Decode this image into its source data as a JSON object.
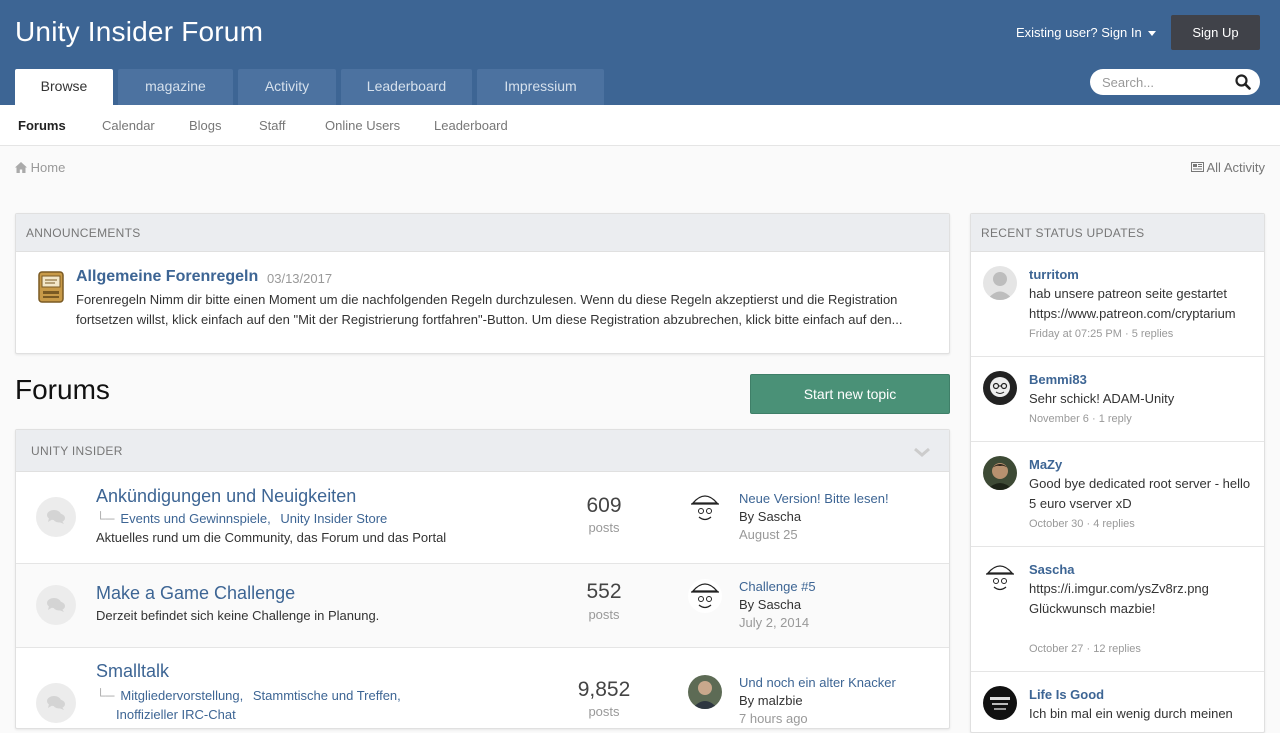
{
  "header": {
    "site_title": "Unity Insider Forum",
    "signin_label": "Existing user? Sign In",
    "signup_label": "Sign Up",
    "tabs": [
      {
        "label": "Browse"
      },
      {
        "label": "magazine"
      },
      {
        "label": "Activity"
      },
      {
        "label": "Leaderboard"
      },
      {
        "label": "Impressium"
      }
    ],
    "search_placeholder": "Search..."
  },
  "subnav": {
    "items": [
      {
        "label": "Forums"
      },
      {
        "label": "Calendar"
      },
      {
        "label": "Blogs"
      },
      {
        "label": "Staff"
      },
      {
        "label": "Online Users"
      },
      {
        "label": "Leaderboard"
      }
    ]
  },
  "breadcrumb": {
    "home": "Home",
    "all_activity": "All Activity"
  },
  "announcements": {
    "heading": "Announcements",
    "title": "Allgemeine Forenregeln",
    "date": "03/13/2017",
    "text": "Forenregeln Nimm dir bitte einen Moment um die nachfolgenden Regeln durchzulesen. Wenn du diese Regeln akzeptierst und die Registration fortsetzen willst, klick einfach auf den \"Mit der Registrierung fortfahren\"-Button. Um diese Registration abzubrechen, klick bitte einfach auf den..."
  },
  "forums": {
    "title": "Forums",
    "start_topic_label": "Start new topic",
    "category": "Unity Insider",
    "rows": [
      {
        "title": "Ankündigungen und Neuigkeiten",
        "subforums": [
          "Events und Gewinnspiele,",
          "Unity Insider Store"
        ],
        "description": "Aktuelles rund um die Community, das Forum und das Portal",
        "count": "609",
        "count_label": "posts",
        "last_title": "Neue Version! Bitte lesen!",
        "last_by": "By Sascha",
        "last_date": "August 25"
      },
      {
        "title": "Make a Game Challenge",
        "description": "Derzeit befindet sich keine Challenge in Planung.",
        "count": "552",
        "count_label": "posts",
        "last_title": "Challenge #5",
        "last_by": "By Sascha",
        "last_date": "July 2, 2014"
      },
      {
        "title": "Smalltalk",
        "subforums": [
          "Mitgliedervorstellung,",
          "Stammtische und Treffen,",
          "Inoffizieller IRC-Chat"
        ],
        "count": "9,852",
        "count_label": "posts",
        "last_title": "Und noch ein alter Knacker",
        "last_by": "By malzbie",
        "last_date": "7 hours ago"
      }
    ]
  },
  "status_updates": {
    "heading": "Recent Status Updates",
    "items": [
      {
        "name": "turritom",
        "text": "hab unsere patreon seite gestartet https://www.patreon.com/cryptarium",
        "meta": "Friday at 07:25 PM · 5 replies"
      },
      {
        "name": "Bemmi83",
        "text": "Sehr schick! ADAM-Unity",
        "meta": "November 6 · 1 reply"
      },
      {
        "name": "MaZy",
        "text": "Good bye dedicated root server  - hello 5 euro vserver xD",
        "meta": "October 30 · 4 replies"
      },
      {
        "name": "Sascha",
        "text": "https://i.imgur.com/ysZv8rz.png Glückwunsch mazbie!",
        "meta": "October 27 · 12 replies"
      },
      {
        "name": "Life Is Good",
        "text": "Ich bin mal ein wenig durch meinen",
        "meta": ""
      }
    ]
  },
  "colors": {
    "header": "#3d6594",
    "accent_button": "#4a9177",
    "link": "#3d6594"
  }
}
